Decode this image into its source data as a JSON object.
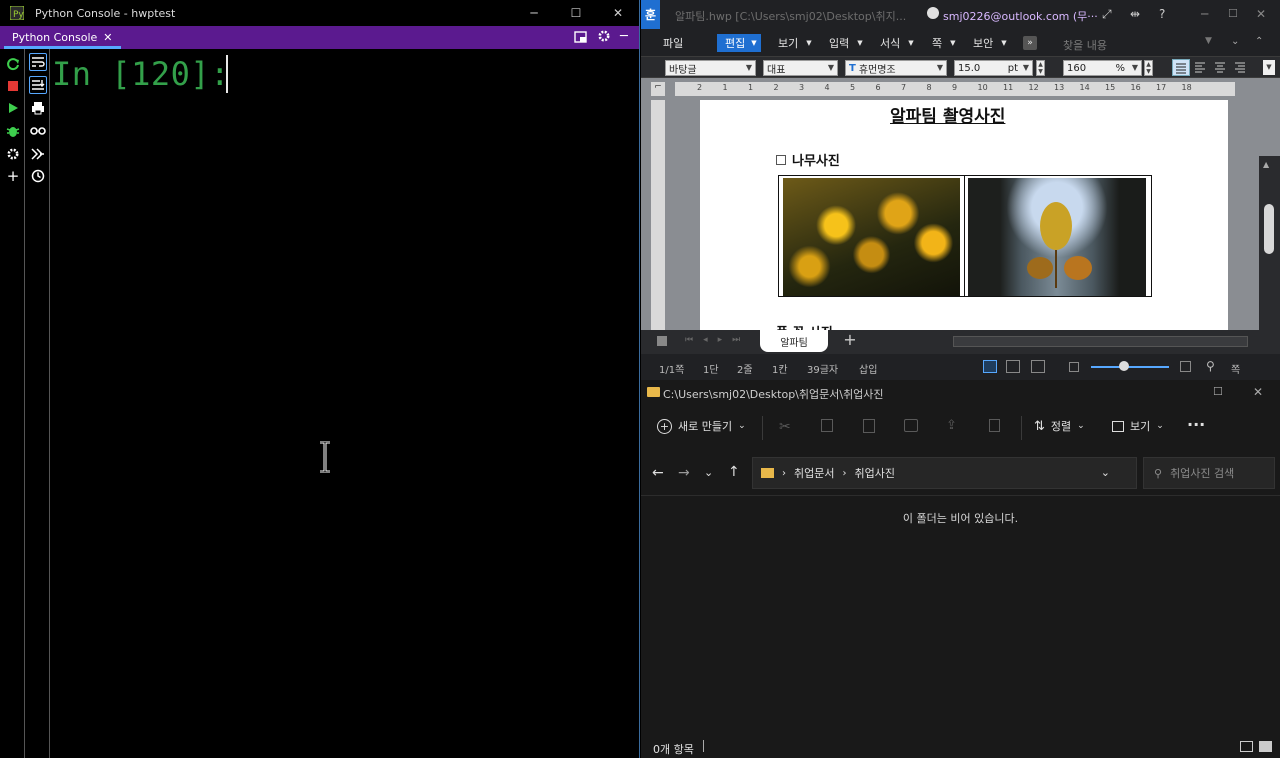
{
  "python": {
    "window_title": "Python Console - hwptest",
    "tab_label": "Python Console",
    "prompt": "In [120]:",
    "minimize_glyph": "─",
    "maximize_glyph": "☐",
    "close_glyph": "✕"
  },
  "hwp": {
    "window_title": "알파팀.hwp [C:\\Users\\smj02\\Desktop\\취지...",
    "account": "smj0226@outlook.com (무···",
    "logo": "훈",
    "menu": {
      "file": "파일",
      "edit": "편집",
      "view": "보기",
      "insert": "입력",
      "format": "서식",
      "page": "쪽",
      "security": "보안",
      "find_placeholder": "찾을 내용"
    },
    "format": {
      "style": "바탕글",
      "lang": "대표",
      "font": "휴먼명조",
      "size": "15.0",
      "size_unit": "pt",
      "line_spacing": "160",
      "spacing_unit": "%"
    },
    "ruler": [
      "2",
      "1",
      "1",
      "2",
      "3",
      "4",
      "5",
      "6",
      "7",
      "8",
      "9",
      "10",
      "11",
      "12",
      "13",
      "14",
      "15",
      "16",
      "17",
      "18"
    ],
    "doc": {
      "title": "알파팀 촬영사진",
      "subtitle": "나무사진",
      "next_line": "풀 꽃 사진"
    },
    "sheet_tab": "알파팀",
    "status": {
      "page": "1/1쪽",
      "section": "1단",
      "line": "2줄",
      "col": "1칸",
      "chars": "39글자",
      "mode": "삽입",
      "fit": "쪽"
    }
  },
  "explorer": {
    "path_title": "C:\\Users\\smj02\\Desktop\\취업문서\\취업사진",
    "new_button": "새로 만들기",
    "sort_button": "정렬",
    "view_button": "보기",
    "more": "···",
    "crumb1": "취업문서",
    "crumb2": "취업사진",
    "search_placeholder": "취업사진 검색",
    "empty_message": "이 폴더는 비어 있습니다.",
    "status": "0개 항목"
  }
}
